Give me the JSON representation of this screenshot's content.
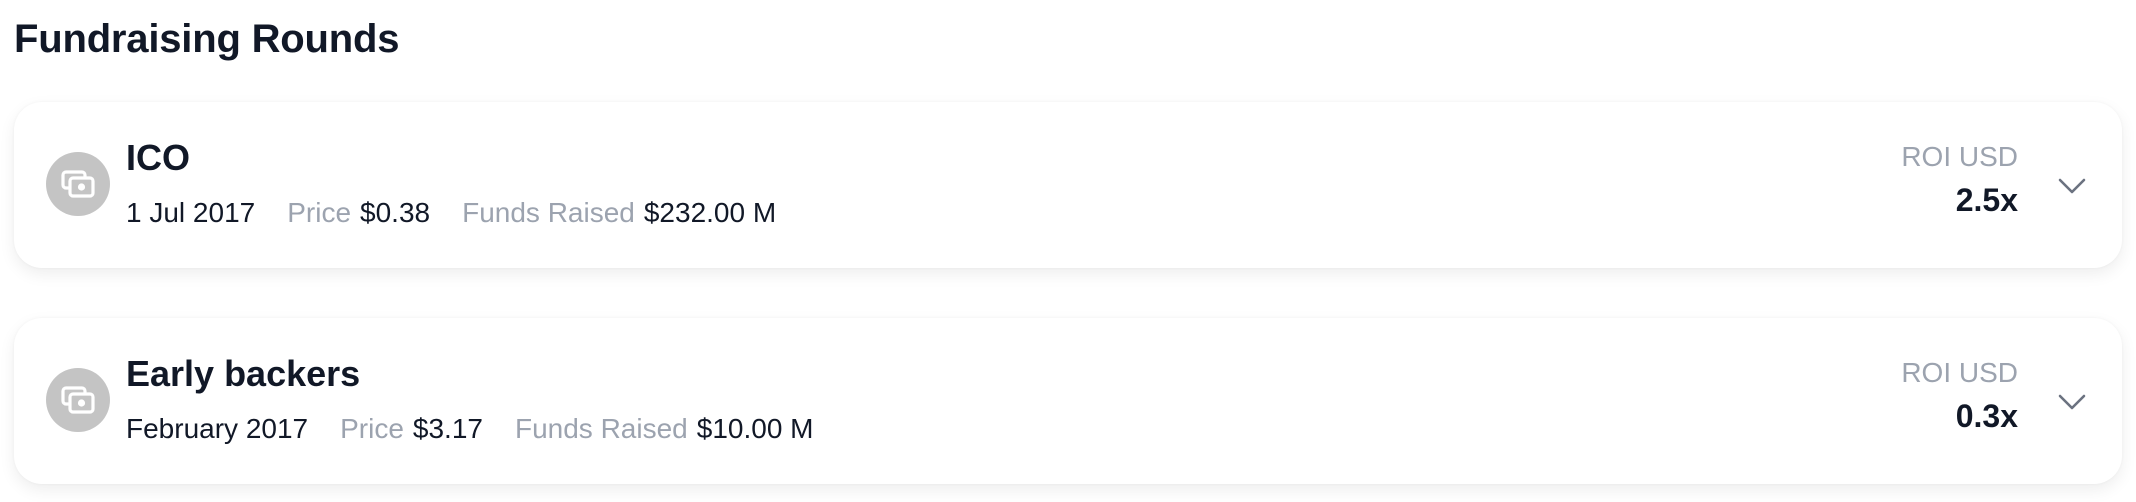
{
  "page": {
    "title": "Fundraising Rounds"
  },
  "labels": {
    "price": "Price",
    "funds_raised": "Funds Raised",
    "roi": "ROI USD"
  },
  "rounds": [
    {
      "name": "ICO",
      "date": "1 Jul 2017",
      "price": "$0.38",
      "funds_raised": "$232.00 M",
      "roi": "2.5x"
    },
    {
      "name": "Early backers",
      "date": "February 2017",
      "price": "$3.17",
      "funds_raised": "$10.00 M",
      "roi": "0.3x"
    }
  ],
  "icons": {
    "round": "cash-icon",
    "expand": "chevron-down-icon"
  },
  "colors": {
    "text": "#111827",
    "muted": "#9ca3af",
    "icon_bg": "#c4c4c4"
  }
}
